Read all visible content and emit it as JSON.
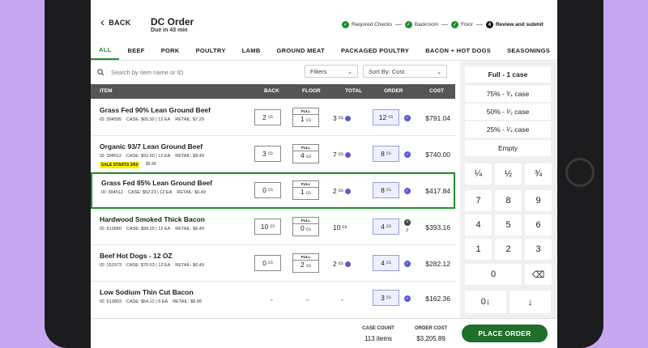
{
  "header": {
    "back_label": "BACK",
    "title": "DC Order",
    "subtitle": "Due in 43 min",
    "steps": [
      {
        "label": "Required Checks",
        "mark": "✓"
      },
      {
        "label": "Backroom",
        "mark": "✓"
      },
      {
        "label": "Floor",
        "mark": "✓"
      },
      {
        "label": "Review and submit",
        "mark": "4"
      }
    ]
  },
  "tabs": [
    "ALL",
    "BEEF",
    "PORK",
    "POULTRY",
    "LAMB",
    "GROUND MEAT",
    "PACKAGED POULTRY",
    "BACON + HOT DOGS",
    "SEASONINGS"
  ],
  "search": {
    "placeholder": "Search by item name or ID"
  },
  "filters": {
    "label": "Filters"
  },
  "sort": {
    "label": "Sort By: Cost"
  },
  "table": {
    "headers": {
      "item": "ITEM",
      "back": "BACK",
      "floor": "FLOOR",
      "total": "TOTAL",
      "order": "ORDER",
      "cost": "COST"
    },
    "unit": "cs",
    "full_label": "FULL",
    "rows": [
      {
        "name": "Grass Fed 90% Lean Ground Beef",
        "id": "ID: 394595",
        "case": "CASE: $65.92 | 12 EA",
        "retail": "RETAIL: $7.29",
        "back": "2",
        "floor": "1",
        "total": "3",
        "order": "12",
        "cost": "$791.04"
      },
      {
        "name": "Organic 93/7 Lean Ground Beef",
        "id": "ID: 394512",
        "case": "CASE: $92.50 | 12 EA",
        "retail": "RETAIL: $8.49",
        "tag": "SALE STARTS 3/60",
        "tag_date": "$5.99",
        "back": "3",
        "floor": "4",
        "total": "7",
        "order": "8",
        "cost": "$740.00"
      },
      {
        "name": "Grass Fed 85% Lean Ground Beef",
        "id": "ID: 394512",
        "case": "CASE: $52.23 | 12 EA",
        "retail": "RETAIL: $6.49",
        "back": "0",
        "floor": "1",
        "total": "2",
        "order": "8",
        "cost": "$417.84"
      },
      {
        "name": "Hardwood Smoked Thick Bacon",
        "id": "ID: 913680",
        "case": "CASE: $98.29 | 12 EA",
        "retail": "RETAIL: $6.49",
        "back": "10",
        "floor": "0",
        "total": "10",
        "order": "4",
        "order_note": "3",
        "cost": "$393.16"
      },
      {
        "name": "Beef Hot Dogs - 12 OZ",
        "id": "ID: 151973",
        "case": "CASE: $70.53 | 12 EA",
        "retail": "RETAIL: $6.49",
        "back": "0",
        "floor": "2",
        "total": "2",
        "order": "4",
        "cost": "$282.12"
      },
      {
        "name": "Low Sodium Thin Cut Bacon",
        "id": "ID: 913803",
        "case": "CASE: $54.12 | 6 EA",
        "retail": "RETAIL: $8.99",
        "back": "-",
        "floor": "-",
        "total": "-",
        "order": "3",
        "cost": "$162.36"
      }
    ]
  },
  "keypad": {
    "fractions": [
      "Full - 1 case",
      "75% - ³⁄₄ case",
      "50% - ¹⁄₂ case",
      "25% - ¹⁄₄ case",
      "Empty"
    ],
    "frac_keys": [
      "¼",
      "½",
      "¾"
    ],
    "digits": [
      "7",
      "8",
      "9",
      "4",
      "5",
      "6",
      "1",
      "2",
      "3"
    ],
    "zero": "0",
    "backspace": "⌫",
    "zero_down": "0↓",
    "down": "↓"
  },
  "footer": {
    "case_count_label": "CASE COUNT",
    "case_count_value": "113 items",
    "order_cost_label": "ORDER COST",
    "order_cost_value": "$3,205.89",
    "place_order_label": "PLACE ORDER"
  },
  "colors": {
    "accent": "#1e8e2e",
    "place_order": "#1f6e2a",
    "order_indicator": "#5a5ad6",
    "background": "#c7a8f0"
  }
}
